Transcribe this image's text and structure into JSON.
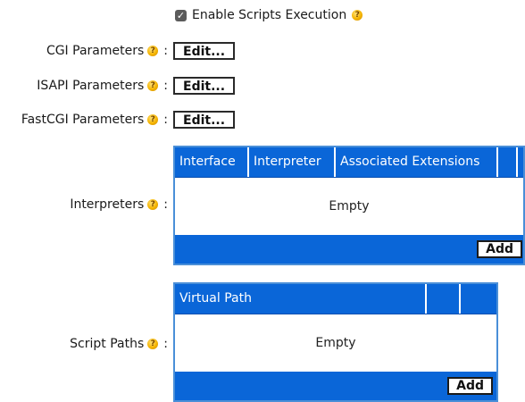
{
  "enable_scripts": {
    "label": "Enable Scripts Execution",
    "checked": true
  },
  "cgi": {
    "label": "CGI Parameters",
    "button": "Edit..."
  },
  "isapi": {
    "label": "ISAPI Parameters",
    "button": "Edit..."
  },
  "fastcgi": {
    "label": "FastCGI Parameters",
    "button": "Edit..."
  },
  "interpreters": {
    "label": "Interpreters",
    "columns": [
      "Interface",
      "Interpreter",
      "Associated Extensions",
      ""
    ],
    "empty_text": "Empty",
    "add_label": "Add"
  },
  "script_paths": {
    "label": "Script Paths",
    "columns": [
      "Virtual Path",
      "",
      ""
    ],
    "empty_text": "Empty",
    "add_label": "Add"
  },
  "colon": ":",
  "help_glyph": "?",
  "check_glyph": "✓",
  "icons": {
    "help": "help-icon",
    "checkbox": "checkbox-checked"
  },
  "colors": {
    "grid_blue": "#0a66d8",
    "help_yellow": "#f5b400"
  }
}
